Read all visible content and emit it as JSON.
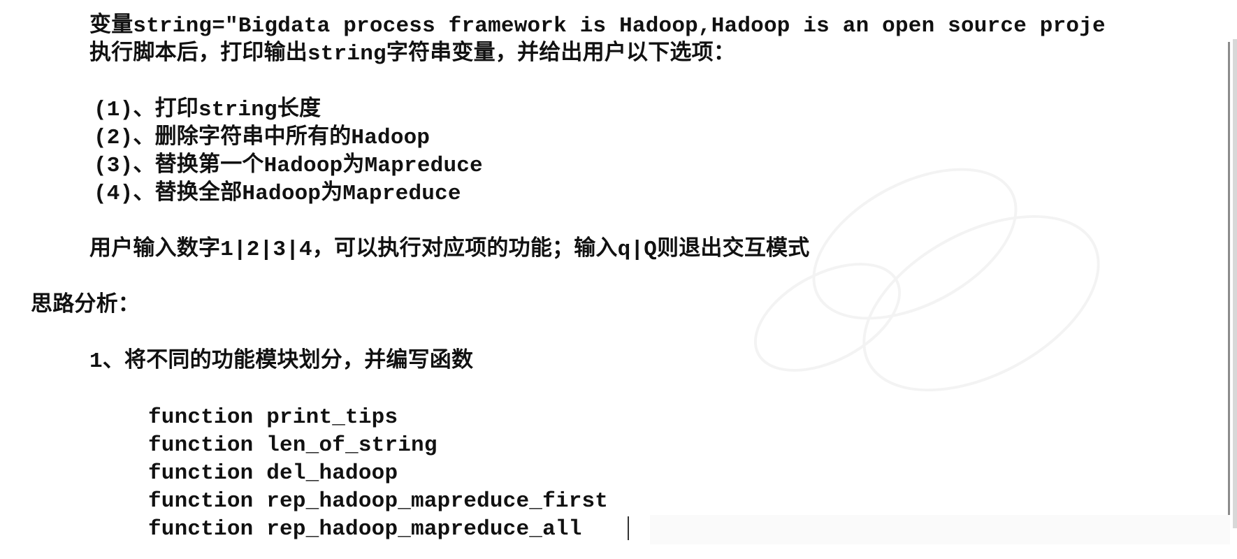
{
  "content": {
    "line1": "变量string=\"Bigdata process framework is Hadoop,Hadoop is an open source proje",
    "line2": "执行脚本后，打印输出string字符串变量，并给出用户以下选项：",
    "options": [
      "(1)、打印string长度",
      "(2)、删除字符串中所有的Hadoop",
      "(3)、替换第一个Hadoop为Mapreduce",
      "(4)、替换全部Hadoop为Mapreduce"
    ],
    "input_hint": "用户输入数字1|2|3|4，可以执行对应项的功能；输入q|Q则退出交互模式",
    "analysis_title": "思路分析：",
    "step1": "1、将不同的功能模块划分，并编写函数",
    "functions": [
      "function print_tips",
      "function len_of_string",
      "function del_hadoop",
      "function rep_hadoop_mapreduce_first",
      "function rep_hadoop_mapreduce_all"
    ]
  }
}
